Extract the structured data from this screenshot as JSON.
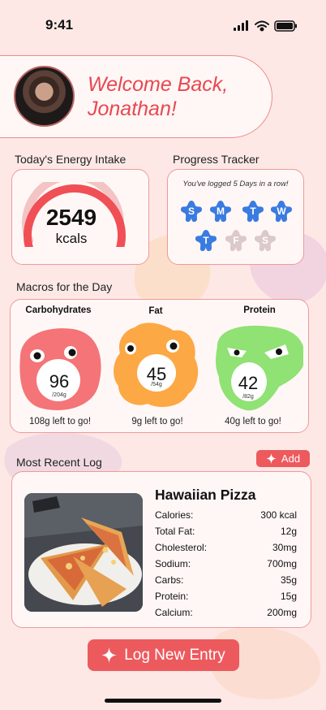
{
  "status_bar": {
    "time": "9:41"
  },
  "welcome": {
    "line1": "Welcome Back,",
    "line2": "Jonathan!"
  },
  "energy": {
    "title": "Today's Energy Intake",
    "value": "2549",
    "unit": "kcals",
    "gauge_fraction": 0.85
  },
  "progress": {
    "title": "Progress Tracker",
    "streak_text": "You've logged 5 Days in a row!",
    "days": [
      {
        "letter": "S",
        "logged": true
      },
      {
        "letter": "M",
        "logged": true
      },
      {
        "letter": "T",
        "logged": true
      },
      {
        "letter": "W",
        "logged": true
      },
      {
        "letter": "T",
        "logged": true
      },
      {
        "letter": "F",
        "logged": false
      },
      {
        "letter": "S",
        "logged": false
      }
    ]
  },
  "macros": {
    "title": "Macros for the Day",
    "items": [
      {
        "name": "Carbohydrates",
        "value": "96",
        "goal": "/204g",
        "left": "108g left to go!",
        "color": "#f47478"
      },
      {
        "name": "Fat",
        "value": "45",
        "goal": "/54g",
        "left": "9g left to go!",
        "color": "#fca845"
      },
      {
        "name": "Protein",
        "value": "42",
        "goal": "/82g",
        "left": "40g left to go!",
        "color": "#8fe273"
      }
    ]
  },
  "recent_log": {
    "title": "Most Recent Log",
    "add_label": "Add",
    "food_name": "Hawaiian Pizza",
    "nutrients": [
      {
        "label": "Calories:",
        "value": "300 kcal"
      },
      {
        "label": "Total Fat:",
        "value": "12g"
      },
      {
        "label": "Cholesterol:",
        "value": "30mg"
      },
      {
        "label": "Sodium:",
        "value": "700mg"
      },
      {
        "label": "Carbs:",
        "value": "35g"
      },
      {
        "label": "Protein:",
        "value": "15g"
      },
      {
        "label": "Calcium:",
        "value": "200mg"
      }
    ]
  },
  "log_new_entry_label": "Log New Entry",
  "colors": {
    "accent": "#ec5a5e",
    "background": "#fde8e6",
    "logged_day": "#3a7be0",
    "unlogged_day": "#dcc9c9"
  }
}
